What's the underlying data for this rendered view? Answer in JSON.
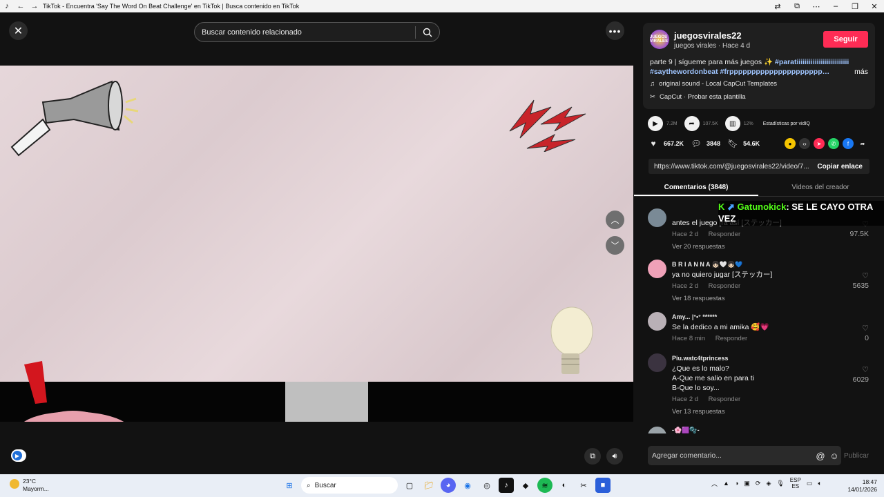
{
  "window": {
    "title": "TikTok - Encuentra 'Say The Word On Beat Challenge' en TikTok | Busca contenido en TikTok"
  },
  "search": {
    "placeholder": "Buscar contenido relacionado"
  },
  "author": {
    "username": "juegosvirales22",
    "subtitle": "juegos virales · Hace 4 d",
    "follow_label": "Seguir",
    "avatar_text": "JUEGOS VIRALES"
  },
  "description": {
    "text": "parte 9 | sígueme para más juegos ✨ ",
    "tag1": "#paratiiiiiiiiiiiiiiiiiiiiiiiiii",
    "tag2": "#saythewordonbeat #frppppppppppppppppppppp…",
    "more_label": "más"
  },
  "music": "original sound - Local CapCut Templates",
  "capcut": "CapCut · Probar esta plantilla",
  "stats": {
    "views": "7.2M",
    "shares": "107.5K",
    "engagement": "12%",
    "vidiq_label": "Estadísticas por vidIQ"
  },
  "actions": {
    "likes": "667.2K",
    "comments": "3848",
    "saves": "54.6K"
  },
  "link": {
    "url": "https://www.tiktok.com/@juegosvirales22/video/7...",
    "copy_label": "Copiar enlace"
  },
  "tabs": [
    {
      "label": "Comentarios (3848)"
    },
    {
      "label": "Videos del creador"
    }
  ],
  "comments": [
    {
      "user": "",
      "text": "antes el juego [ra así [ステッカー]",
      "time": "Hace 2 d",
      "reply": "Responder",
      "replies": "Ver 20 respuestas",
      "likes": "97.5K"
    },
    {
      "user": "B R I A N N A 👧🏻🤍👧🏻💙",
      "text": "ya no quiero jugar [ステッカー]",
      "time": "Hace 2 d",
      "reply": "Responder",
      "replies": "Ver 18 respuestas",
      "likes": "5635"
    },
    {
      "user": "Amy... |°•° ******",
      "text": "Se la dedico a mi amika 🥰💗",
      "time": "Hace 8 min",
      "reply": "Responder",
      "replies": "",
      "likes": "0"
    },
    {
      "user": "Piu.watc4tprincess",
      "text1": "¿Que es lo malo?",
      "text2": "A-Que me salio en para ti",
      "text3": "B-Que lo soy...",
      "time": "Hace 2 d",
      "reply": "Responder",
      "replies": "Ver 13 respuestas",
      "likes": "6029"
    },
    {
      "user": "-🌸🟪🫧-"
    }
  ],
  "kick": {
    "name": "Gatunokick",
    "message": ": SE LE CAYO OTRA VEZ"
  },
  "add_comment": {
    "placeholder": "Agregar comentario...",
    "publish_label": "Publicar"
  },
  "taskbar": {
    "temperature": "23°C",
    "weather_text": "Mayorm...",
    "search_label": "Buscar",
    "lang_top": "ESP",
    "lang_bottom": "ES",
    "time": "18:47",
    "date": "14/01/2026"
  }
}
